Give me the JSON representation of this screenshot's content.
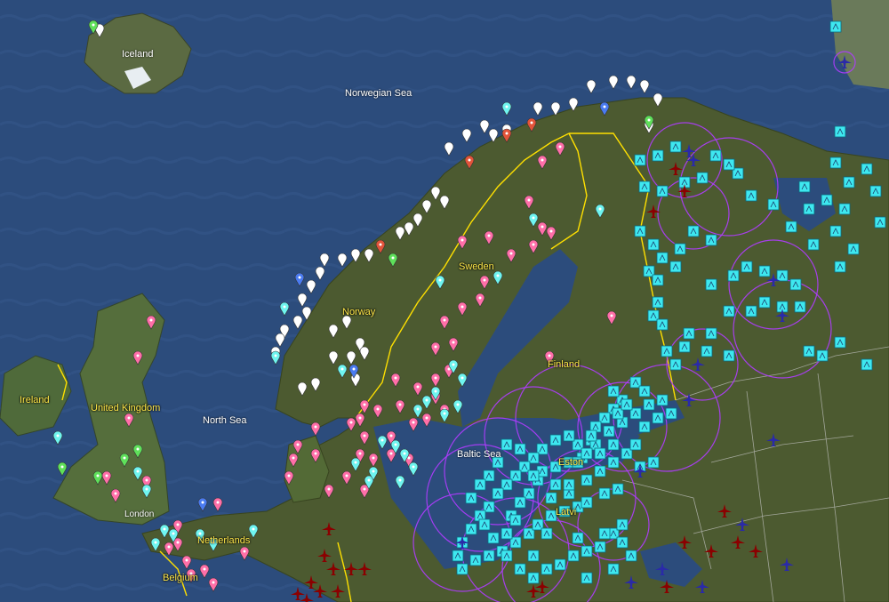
{
  "map": {
    "labels": {
      "iceland": "Iceland",
      "norwegian_sea": "Norwegian Sea",
      "norway": "Norway",
      "sweden": "Sweden",
      "finland": "Finland",
      "ireland": "Ireland",
      "united_kingdom": "United Kingdom",
      "north_sea": "North Sea",
      "baltic_sea": "Baltic Sea",
      "estonia": "Eston",
      "latvia": "Latvi",
      "london": "London",
      "netherlands": "Netherlands",
      "belgium": "Belgium"
    },
    "colors": {
      "ocean": "#2a4a7a",
      "land": "#4a5a32",
      "border": "#ffe000",
      "white_marker": "#ffffff",
      "pink_marker": "#ff6fa8",
      "cyan_marker": "#6ff5f0",
      "red_marker": "#e2543a",
      "green_marker": "#5fe05a",
      "blue_marker": "#4a7bf0",
      "unit_tile": "#3ee8f0",
      "range_ring": "#b03cff",
      "enemy_air": "#8b0000",
      "friendly_air": "#2a2aa8"
    },
    "icons": [
      "map-pin-icon",
      "unit-tile-icon",
      "aircraft-icon",
      "range-ring"
    ]
  }
}
